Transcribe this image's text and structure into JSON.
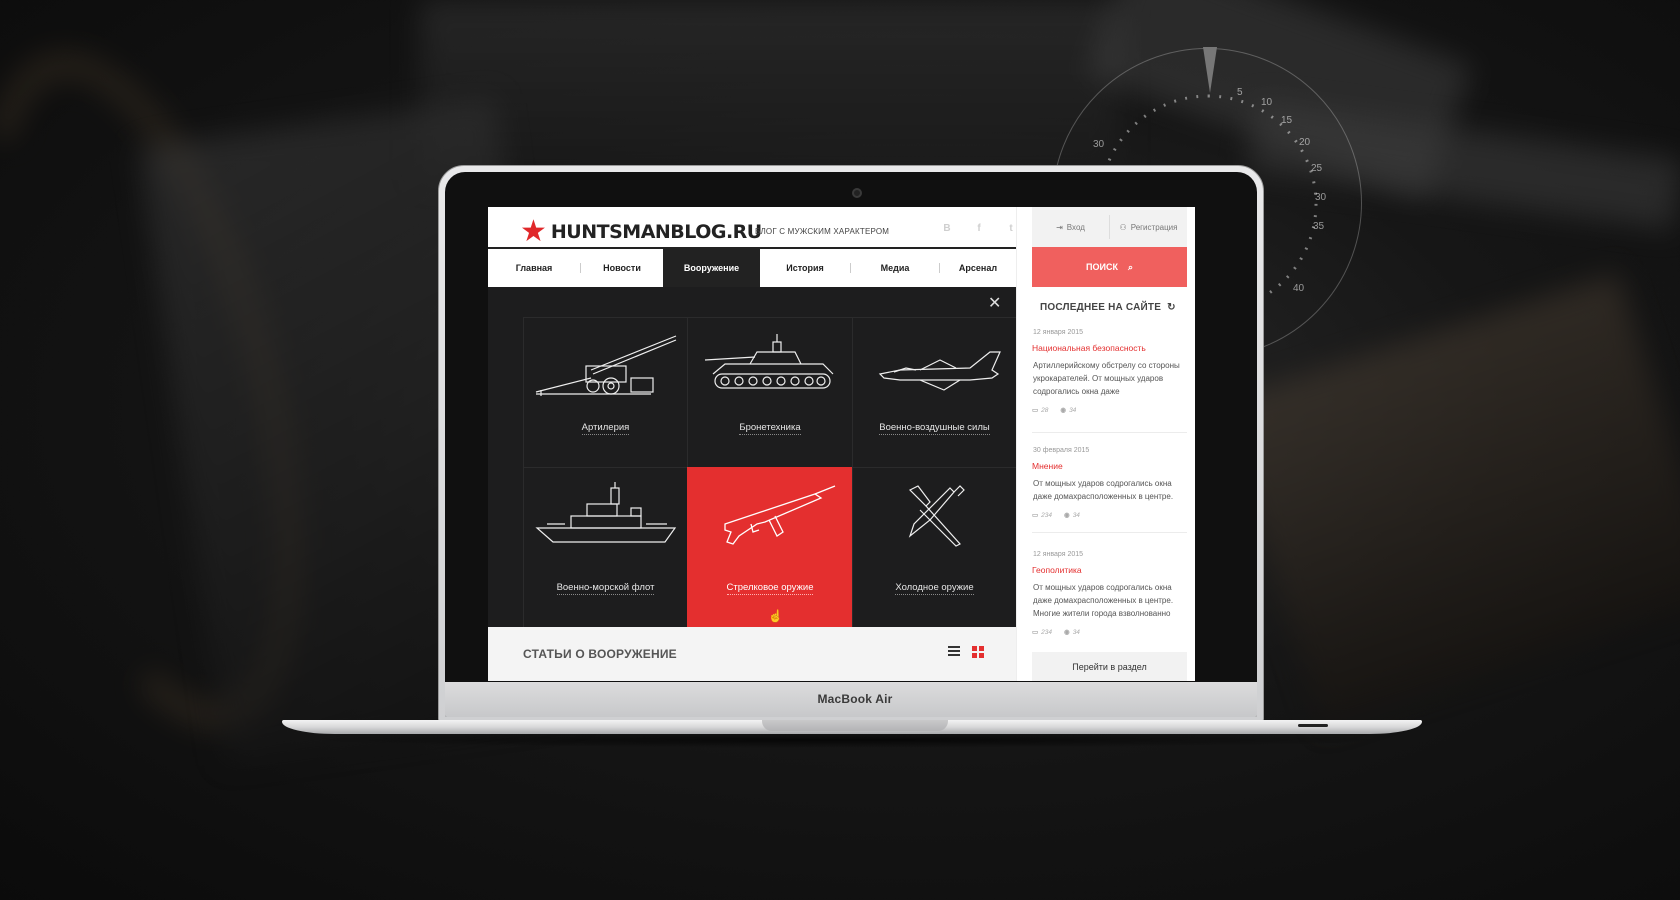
{
  "device": {
    "label": "MacBook Air"
  },
  "dial": {
    "numbers": [
      "5",
      "10",
      "15",
      "20",
      "25",
      "30",
      "35",
      "40",
      "30"
    ]
  },
  "site": {
    "logo_text": "HUNTSMANBLOG.RU",
    "tagline": "БЛОГ С МУЖСКИМ ХАРАКТЕРОМ",
    "socials": [
      "B",
      "f",
      "t"
    ]
  },
  "nav": {
    "items": [
      {
        "label": "Главная"
      },
      {
        "label": "Новости"
      },
      {
        "label": "Вооружение",
        "active": true
      },
      {
        "label": "История"
      },
      {
        "label": "Медиа"
      },
      {
        "label": "Арсенал"
      }
    ]
  },
  "mega_menu": {
    "categories": [
      {
        "label": "Артилерия",
        "icon": "artillery-icon"
      },
      {
        "label": "Бронетехника",
        "icon": "tank-icon"
      },
      {
        "label": "Военно-воздушные силы",
        "icon": "jet-icon"
      },
      {
        "label": "Военно-морской флот",
        "icon": "warship-icon"
      },
      {
        "label": "Стрелковое оружие",
        "icon": "rifle-icon",
        "active": true
      },
      {
        "label": "Холодное оружие",
        "icon": "knife-icon"
      }
    ]
  },
  "articles": {
    "title": "СТАТЬИ О ВООРУЖЕНИЕ"
  },
  "sidebar": {
    "login": "Вход",
    "register": "Регистрация",
    "search": "ПОИСК",
    "latest_title": "ПОСЛЕДНЕЕ НА САЙТЕ",
    "posts": [
      {
        "date": "12 января 2015",
        "category": "Национальная безопасность",
        "text": "Артиллерийскому обстрелу со стороны укрокарателей. От мощных ударов содрогались окна даже",
        "comments": "28",
        "views": "34"
      },
      {
        "date": "30 февраля 2015",
        "category": "Мнение",
        "text": "От мощных ударов содрогались окна даже домахрасположенных в центре.",
        "comments": "234",
        "views": "34"
      },
      {
        "date": "12 января 2015",
        "category": "Геополитика",
        "text": "От мощных ударов содрогались окна даже домахрасположенных в центре. Многие жители города взволнованно",
        "comments": "234",
        "views": "34"
      }
    ],
    "goto": "Перейти в раздел"
  },
  "colors": {
    "accent": "#e42f2f",
    "search": "#f0605e",
    "dark": "#1d1d1e"
  }
}
